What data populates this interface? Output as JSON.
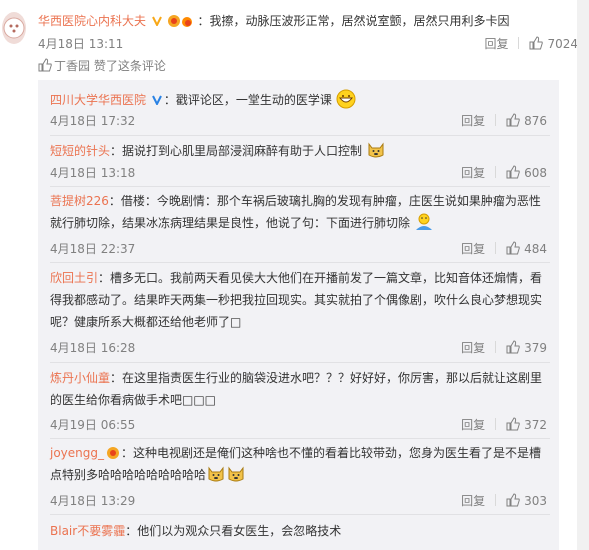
{
  "main_comment": {
    "user": "华西医院心内科大夫",
    "text": "：我擦，动脉压波形正常，居然说室颤，居然只用利多卡因",
    "date": "4月18日 13:11",
    "reply_label": "回复",
    "like_count": "7024",
    "liked_by": "丁香园 赞了这条评论",
    "colors": {
      "username": "#eb7350",
      "meta": "#808080",
      "panel": "#f2f2f5"
    }
  },
  "replies": [
    {
      "user": "四川大学华西医院",
      "text": "：戳评论区，一堂生动的医学课",
      "date": "4月18日 17:32",
      "reply_label": "回复",
      "likes": "876",
      "emoji": "grin-emoji",
      "verified": true
    },
    {
      "user": "短短的针头",
      "text": "：据说打到心肌里局部浸润麻醉有助于人口控制",
      "date": "4月18日 13:18",
      "reply_label": "回复",
      "likes": "608",
      "emoji": "doge-emoji"
    },
    {
      "user": "菩提树226",
      "text": "：借楼：今晚剧情：那个车祸后玻璃扎胸的发现有肿瘤，庄医生说如果肿瘤为恶性就行肺切除，结果冰冻病理结果是良性，他说了句：下面进行肺切除",
      "date": "4月18日 22:37",
      "reply_label": "回复",
      "likes": "484",
      "emoji": "shrug-emoji"
    },
    {
      "user": "欣回土引",
      "text": "：槽多无口。我前两天看见侯大大他们在开播前发了一篇文章，比知音体还煽情，看得我都感动了。结果昨天两集一秒把我拉回现实。其实就拍了个偶像剧，吹什么良心梦想现实呢？健康所系大概都还给他老师了□",
      "date": "4月18日 16:28",
      "reply_label": "回复",
      "likes": "379"
    },
    {
      "user": "炼丹小仙童",
      "text": "：在这里指责医生行业的脑袋没进水吧？？？好好好，你厉害，那以后就让这剧里的医生给你看病做手术吧□□□",
      "date": "4月19日 06:55",
      "reply_label": "回复",
      "likes": "372"
    },
    {
      "user": "joyengg_",
      "text": "：这种电视剧还是俺们这种啥也不懂的看着比较带劲，您身为医生看了是不是槽点特别多哈哈哈哈哈哈哈哈哈",
      "date": "4月18日 13:29",
      "reply_label": "回复",
      "likes": "303",
      "emoji": "doge-emoji",
      "has_medal": true
    },
    {
      "user": "Blair不要雾霾",
      "text": "：他们以为观众只看女医生，会忽略技术"
    }
  ]
}
